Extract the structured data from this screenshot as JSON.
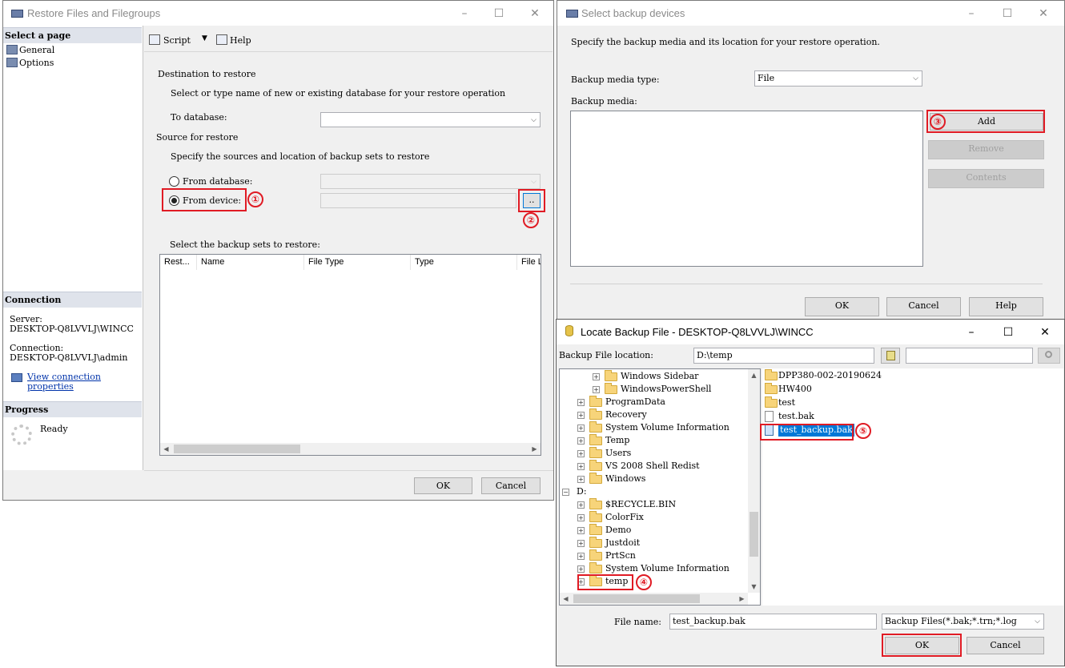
{
  "restore_window": {
    "title": "Restore Files and Filegroups",
    "select_page_header": "Select a page",
    "nav_items": [
      "General",
      "Options"
    ],
    "toolbar": {
      "script_label": "Script",
      "help_label": "Help"
    },
    "destination_header": "Destination to restore",
    "destination_desc": "Select or type name of new or existing database for your restore operation",
    "to_database_label": "To database:",
    "to_database_value": "",
    "source_header": "Source for restore",
    "source_desc": "Specify the sources and location of backup sets to restore",
    "from_database_label": "From database:",
    "from_device_label": "From device:",
    "browse_label": "..",
    "backup_sets_label": "Select the backup sets to restore:",
    "columns": [
      "Rest...",
      "Name",
      "File Type",
      "Type",
      "File L"
    ],
    "connection_header": "Connection",
    "server_label": "Server:",
    "server_value": "DESKTOP-Q8LVVLJ\\WINCC",
    "connection_label": "Connection:",
    "connection_value": "DESKTOP-Q8LVVLJ\\admin",
    "view_props_line1": "View connection",
    "view_props_line2": "properties",
    "progress_header": "Progress",
    "progress_status": "Ready",
    "ok_label": "OK",
    "cancel_label": "Cancel"
  },
  "backup_devices_window": {
    "title": "Select backup devices",
    "description": "Specify the backup media and its location for your restore operation.",
    "media_type_label": "Backup media type:",
    "media_type_value": "File",
    "media_label": "Backup media:",
    "add_label": "Add",
    "remove_label": "Remove",
    "contents_label": "Contents",
    "ok_label": "OK",
    "cancel_label": "Cancel",
    "help_label": "Help"
  },
  "locate_window": {
    "title": "Locate Backup File - DESKTOP-Q8LVVLJ\\WINCC",
    "location_label": "Backup File location:",
    "location_value": "D:\\temp",
    "search_value": "",
    "tree": [
      {
        "label": "Windows Sidebar",
        "indent": 2
      },
      {
        "label": "WindowsPowerShell",
        "indent": 2
      },
      {
        "label": "ProgramData",
        "indent": 1
      },
      {
        "label": "Recovery",
        "indent": 1
      },
      {
        "label": "System Volume Information",
        "indent": 1
      },
      {
        "label": "Temp",
        "indent": 1
      },
      {
        "label": "Users",
        "indent": 1
      },
      {
        "label": "VS 2008 Shell Redist",
        "indent": 1
      },
      {
        "label": "Windows",
        "indent": 1
      },
      {
        "label": "D:",
        "indent": 0
      },
      {
        "label": "$RECYCLE.BIN",
        "indent": 1
      },
      {
        "label": "ColorFix",
        "indent": 1
      },
      {
        "label": "Demo",
        "indent": 1
      },
      {
        "label": "Justdoit",
        "indent": 1
      },
      {
        "label": "PrtScn",
        "indent": 1
      },
      {
        "label": "System Volume Information",
        "indent": 1
      },
      {
        "label": "temp",
        "indent": 1
      }
    ],
    "files": [
      {
        "label": "DPP380-002-20190624",
        "kind": "folder"
      },
      {
        "label": "HW400",
        "kind": "folder"
      },
      {
        "label": "test",
        "kind": "folder"
      },
      {
        "label": "test.bak",
        "kind": "file"
      },
      {
        "label": "test_backup.bak",
        "kind": "file",
        "selected": true
      }
    ],
    "file_name_label": "File name:",
    "file_name_value": "test_backup.bak",
    "filter_value": "Backup Files(*.bak;*.trn;*.log",
    "ok_label": "OK",
    "cancel_label": "Cancel"
  },
  "annotations": [
    "①",
    "②",
    "③",
    "④",
    "⑤"
  ],
  "colors": {
    "annotation_red": "#e01b24",
    "selection_blue": "#0078d7",
    "nav_header": "#dfe3eb"
  }
}
